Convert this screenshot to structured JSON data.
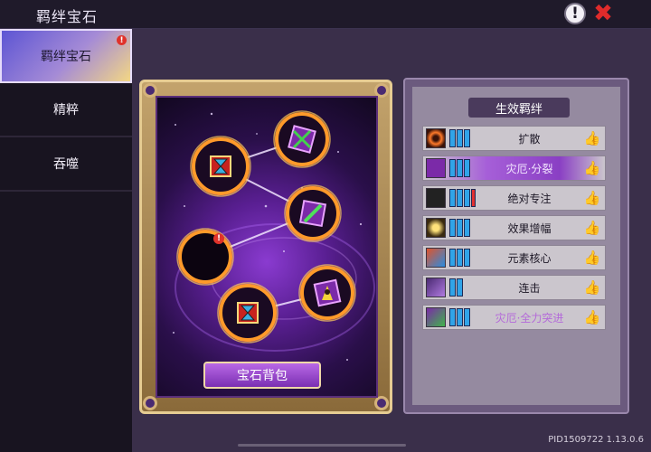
{
  "header": {
    "title": "羁绊宝石",
    "info_icon": "exclamation-icon",
    "close_icon": "close-x-icon"
  },
  "sidebar": {
    "tabs": [
      {
        "label": "羁绊宝石",
        "active": true,
        "alert": "!"
      },
      {
        "label": "精粹",
        "active": false
      },
      {
        "label": "吞噬",
        "active": false
      }
    ]
  },
  "board": {
    "bag_button": "宝石背包",
    "empty_slot_alert": "!",
    "gems": [
      "hourglass-gem",
      "crossed-arrows-gem",
      "green-sword-gem",
      "empty-slot",
      "hourglass-gem",
      "flower-aura-gem"
    ]
  },
  "bonds": {
    "title": "生效羁绊",
    "items": [
      {
        "name": "扩散",
        "icon": "orange-ring-icon",
        "pips": 3,
        "alert": false,
        "active": false,
        "purple": false
      },
      {
        "name": "灾厄·分裂",
        "icon": "green-sword-icon",
        "pips": 3,
        "alert": false,
        "active": true,
        "purple": true
      },
      {
        "name": "绝对专注",
        "icon": "hourglass-icon",
        "pips": 3,
        "alert": true,
        "active": false,
        "purple": false
      },
      {
        "name": "效果增幅",
        "icon": "sparkle-burst-icon",
        "pips": 3,
        "alert": false,
        "active": false,
        "purple": false
      },
      {
        "name": "元素核心",
        "icon": "element-orb-icon",
        "pips": 3,
        "alert": false,
        "active": false,
        "purple": false
      },
      {
        "name": "连击",
        "icon": "purple-blade-icon",
        "pips": 2,
        "alert": false,
        "active": false,
        "purple": false
      },
      {
        "name": "灾厄·全力突进",
        "icon": "green-claw-icon",
        "pips": 3,
        "alert": false,
        "active": false,
        "purple": true
      }
    ]
  },
  "version": "PID1509722 1.13.0.6",
  "colors": {
    "accent_purple": "#8a3fc4",
    "pip_blue": "#31a4e8",
    "alert_red": "#e0322a",
    "gold": "#e6cc92"
  }
}
